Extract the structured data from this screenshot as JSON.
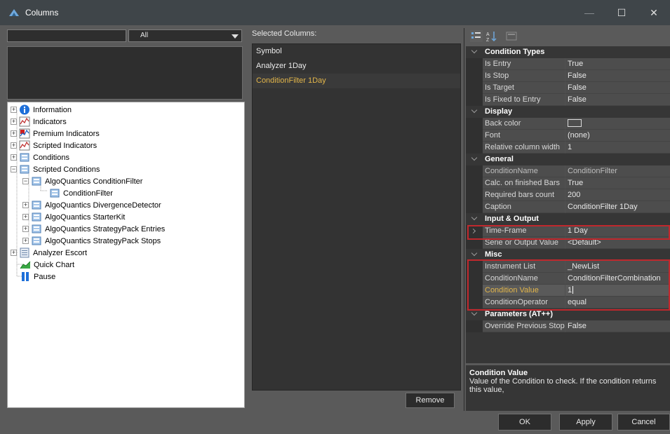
{
  "window": {
    "title": "Columns",
    "minimize": "—",
    "maximize": "☐",
    "close": "✕"
  },
  "left": {
    "search_value": "",
    "filter_selected": "All",
    "tree": [
      {
        "label": "Information",
        "icon": "info-icon",
        "expander": "+"
      },
      {
        "label": "Indicators",
        "icon": "indicator-icon",
        "expander": "+"
      },
      {
        "label": "Premium Indicators",
        "icon": "premium-indicator-icon",
        "expander": "+"
      },
      {
        "label": "Scripted Indicators",
        "icon": "scripted-indicator-icon",
        "expander": "+"
      },
      {
        "label": "Conditions",
        "icon": "condition-icon",
        "expander": "+"
      },
      {
        "label": "Scripted Conditions",
        "icon": "condition-icon",
        "expander": "−"
      },
      {
        "label": "AlgoQuantics ConditionFilter",
        "icon": "condition-icon",
        "expander": "−"
      },
      {
        "label": "ConditionFilter",
        "icon": "condition-icon",
        "expander": ""
      },
      {
        "label": "AlgoQuantics DivergenceDetector",
        "icon": "condition-icon",
        "expander": "+"
      },
      {
        "label": "AlgoQuantics StarterKit",
        "icon": "condition-icon",
        "expander": "+"
      },
      {
        "label": "AlgoQuantics StrategyPack Entries",
        "icon": "condition-icon",
        "expander": "+"
      },
      {
        "label": "AlgoQuantics StrategyPack Stops",
        "icon": "condition-icon",
        "expander": "+"
      },
      {
        "label": "Analyzer Escort",
        "icon": "analyzer-icon",
        "expander": "+"
      },
      {
        "label": "Quick Chart",
        "icon": "chart-icon",
        "expander": ""
      },
      {
        "label": "Pause",
        "icon": "pause-icon",
        "expander": ""
      }
    ]
  },
  "middle": {
    "label": "Selected Columns:",
    "items": [
      "Symbol",
      "Analyzer 1Day",
      "ConditionFilter 1Day"
    ],
    "remove_label": "Remove"
  },
  "grid": {
    "categories": [
      {
        "name": "Condition Types",
        "rows": [
          {
            "name": "Is Entry",
            "value": "True"
          },
          {
            "name": "Is Stop",
            "value": "False"
          },
          {
            "name": "Is Target",
            "value": "False"
          },
          {
            "name": "Is Fixed to Entry",
            "value": "False"
          }
        ]
      },
      {
        "name": "Display",
        "rows": [
          {
            "name": "Back color",
            "value": ""
          },
          {
            "name": "Font",
            "value": "(none)"
          },
          {
            "name": "Relative column width",
            "value": "1"
          }
        ]
      },
      {
        "name": "General",
        "rows": [
          {
            "name": "ConditionName",
            "value": "ConditionFilter"
          },
          {
            "name": "Calc. on finished Bars",
            "value": "True"
          },
          {
            "name": "Required bars count",
            "value": "200"
          },
          {
            "name": "Caption",
            "value": "ConditionFilter 1Day"
          }
        ]
      },
      {
        "name": "Input & Output",
        "rows": [
          {
            "name": "Time-Frame",
            "value": "1 Day"
          },
          {
            "name": "Serie or Output Value",
            "value": "<Default>"
          }
        ]
      },
      {
        "name": "Misc",
        "rows": [
          {
            "name": "Instrument List",
            "value": "_NewList"
          },
          {
            "name": "ConditionName",
            "value": "ConditionFilterCombination"
          },
          {
            "name": "Condition Value",
            "value": "1"
          },
          {
            "name": "ConditionOperator",
            "value": "equal"
          }
        ]
      },
      {
        "name": "Parameters (AT++)",
        "rows": [
          {
            "name": "Override Previous Stop",
            "value": "False"
          }
        ]
      }
    ]
  },
  "description": {
    "title": "Condition Value",
    "text": "Value of the Condition to check. If the condition returns this value,"
  },
  "buttons": {
    "ok": "OK",
    "apply": "Apply",
    "cancel": "Cancel"
  }
}
